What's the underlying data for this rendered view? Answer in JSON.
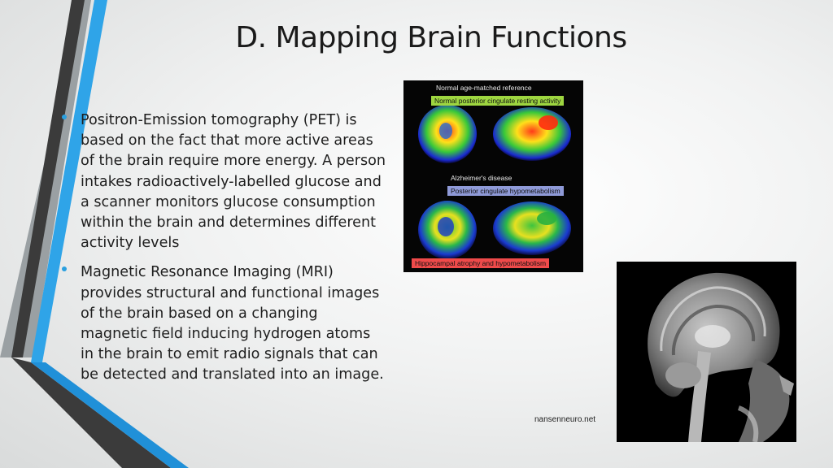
{
  "slide": {
    "title": "D. Mapping Brain Functions",
    "bullets": [
      "Positron-Emission tomography (PET) is based on the fact that more active areas of the brain require more energy. A person intakes radioactively-labelled glucose and a scanner monitors glucose consumption within the brain and determines different activity levels",
      "Magnetic Resonance Imaging (MRI) provides structural and functional images of the brain based on a changing magnetic field inducing hydrogen atoms in the brain to emit radio signals that can be detected and translated into an image."
    ],
    "credit": "nansenneuro.net"
  },
  "pet_figure": {
    "normal_heading": "Normal age-matched reference",
    "normal_box": "Normal posterior cingulate resting activity",
    "normal_box_color": "#9ed640",
    "alz_heading": "Alzheimer's disease",
    "alz_box": "Posterior cingulate hypometabolism",
    "alz_box_color": "#8f9ad8",
    "bottom_box": "Hippocampal atrophy and hypometabolism",
    "bottom_box_color": "#ef4a4a"
  },
  "theme": {
    "accent_blue": "#2aa0e0",
    "stripe_dark": "#3a3a3a",
    "stripe_blue": "#1f8ad6"
  }
}
